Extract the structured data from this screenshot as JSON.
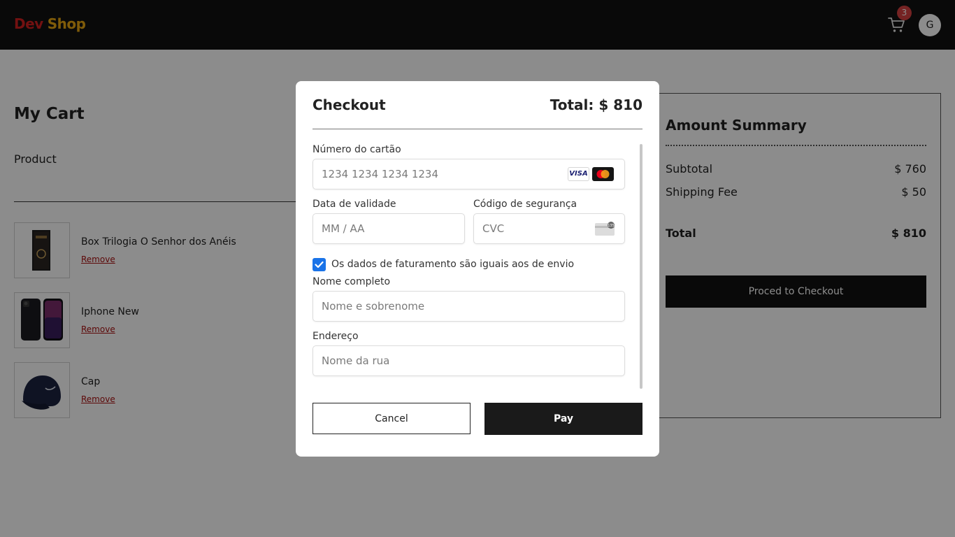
{
  "header": {
    "logo_part1": "Dev",
    "logo_part2": "Shop",
    "cart_count": "3",
    "avatar_initial": "G",
    "icon": "cart-icon"
  },
  "cart": {
    "title": "My Cart",
    "product_header": "Product",
    "items": [
      {
        "name": "Box Trilogia O Senhor dos Anéis",
        "remove": "Remove"
      },
      {
        "name": "Iphone New",
        "remove": "Remove"
      },
      {
        "name": "Cap",
        "remove": "Remove"
      }
    ]
  },
  "summary": {
    "title": "Amount Summary",
    "subtotal_label": "Subtotal",
    "subtotal_value": "$ 760",
    "shipping_label": "Shipping Fee",
    "shipping_value": "$ 50",
    "total_label": "Total",
    "total_value": "$ 810",
    "proceed_label": "Proced to Checkout"
  },
  "modal": {
    "title": "Checkout",
    "total": "Total: $ 810",
    "card_number_label": "Número do cartão",
    "card_number_placeholder": "1234 1234 1234 1234",
    "card_brand_visa": "VISA",
    "expiry_label": "Data de validade",
    "expiry_placeholder": "MM / AA",
    "cvc_label": "Código de segurança",
    "cvc_placeholder": "CVC",
    "cvc_icon_text": "135",
    "same_billing_label": "Os dados de faturamento são iguais aos de envio",
    "same_billing_checked": true,
    "name_label": "Nome completo",
    "name_placeholder": "Nome e sobrenome",
    "address_label": "Endereço",
    "address_placeholder": "Nome da rua",
    "cancel_label": "Cancel",
    "pay_label": "Pay"
  },
  "colors": {
    "header_bg": "#121212",
    "logo_dev": "#d12020",
    "logo_shop": "#e8a712",
    "badge": "#d64040",
    "checkbox": "#1a73e8",
    "button_dark": "#1a1a1a"
  }
}
